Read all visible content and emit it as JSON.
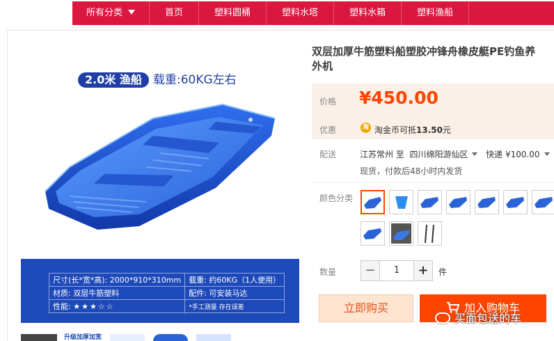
{
  "nav": {
    "items": [
      {
        "label": "所有分类"
      },
      {
        "label": "首页"
      },
      {
        "label": "塑料圆桶"
      },
      {
        "label": "塑料水塔"
      },
      {
        "label": "塑料水箱"
      },
      {
        "label": "塑料渔船"
      }
    ]
  },
  "gallery": {
    "badge": "2.0米 渔船",
    "load": "载重:60KG左右",
    "spec": {
      "size": "尺寸(长*宽*高): 2000*910*310mm",
      "weight": "载重: 约60KG（1人使用）",
      "material": "材质: 双层牛筋塑料",
      "accessory": "配件: 可安装马达",
      "performance": "性能:",
      "stars": "★★★☆☆",
      "note": "*手工测量 存在误差"
    },
    "thumb_caption": "升级加厚加宽"
  },
  "product": {
    "title_line1": "双层加厚牛筋塑料船塑胶冲锋舟橡皮艇PE钓鱼养",
    "title_line2": "外机",
    "price_label": "价格",
    "price": "¥450.00",
    "promo_label": "优惠",
    "promo_icon": "淘",
    "promo_text_a": "淘金币可抵",
    "promo_text_b": "13.50",
    "promo_text_c": "元",
    "ship_label": "配送",
    "ship_from": "江苏常州 至",
    "ship_to": "四川绵阳游仙区",
    "ship_method": "快递 ¥100.00",
    "ship_note": "现货，付款后48小时内发货",
    "color_label": "颜色分类",
    "qty_label": "数量",
    "qty_value": "1",
    "qty_minus": "−",
    "qty_plus": "+",
    "qty_unit": "件",
    "buy_now": "立即购买",
    "add_cart": "加入购物车",
    "watermark": "买面包送的车"
  },
  "colors": {
    "accent": "#ff4400",
    "nav": "#d9173f",
    "boat": "#1e49c8"
  }
}
